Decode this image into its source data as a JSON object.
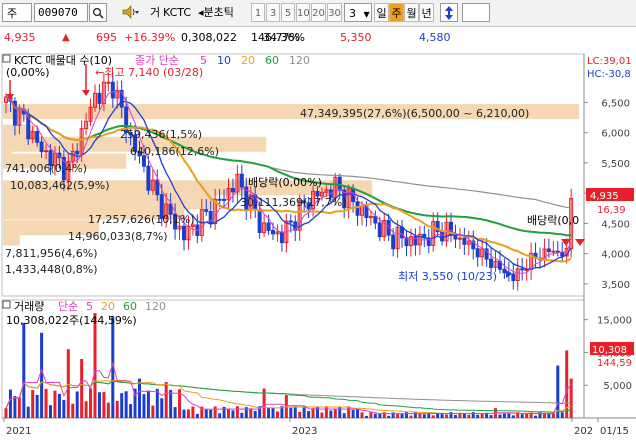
{
  "toolbar": {
    "market_btn": "주",
    "code_value": "009070",
    "search_icon": "search-icon",
    "speaker_icon": "speaker-icon",
    "name_prefix": "거",
    "stock_name": "KCTC",
    "tick_label": "◂분초틱",
    "intervals": [
      "1",
      "3",
      "5",
      "10",
      "20",
      "30"
    ],
    "count_value": "3",
    "periods": [
      "일",
      "주",
      "월",
      "년"
    ],
    "active_period": "주"
  },
  "quote": {
    "price": "4,935",
    "change": "695",
    "change_rate": "+16.39%",
    "volume": "0,308,022",
    "vol_ratio": "146.77%",
    "turnover": "34.36%",
    "high": "5,350",
    "low": "4,580"
  },
  "price_panel": {
    "legend_name": "KCTC 매물대 수(10)",
    "legend_ma_label": "종가 단순",
    "legend_ma_periods": [
      "5",
      "10",
      "20",
      "60",
      "120"
    ],
    "legend_change": "(0,00%)",
    "lc_label": "LC:39,01",
    "hc_label": "HC:-30,8",
    "high_label": "최고 7,140 (03/28)",
    "low_label": "최저 3,550 (10/23)",
    "dividend_labels": [
      "배당락(0,00%)",
      "배당락(0,0"
    ],
    "price_tag": "4,935",
    "change_tag": "16,39",
    "y_ticks": [
      "6,500",
      "6,000",
      "5,500",
      "5,000",
      "4,500",
      "4,000",
      "3,500"
    ],
    "profile_labels": [
      "47,349,395(27,6%)(6,500,00 ~ 6,210,00)",
      "259,436(1,5%)",
      "640,186(12,6%)",
      "741,006(0,4%)",
      "10,083,462(5,9%)",
      "30,111,369(17,7%)",
      "17,257,626(10,1%)",
      "14,960,033(8,7%)",
      "7,811,956(4,6%)",
      "1,433,448(0,8%)"
    ],
    "profile_fractions": [
      1.0,
      0.055,
      0.457,
      0.015,
      0.214,
      0.641,
      0.366,
      0.315,
      0.167,
      0.029
    ]
  },
  "volume_panel": {
    "legend_name": "거래량",
    "legend_ma_label": "단순",
    "legend_ma_periods": [
      "5",
      "20",
      "60",
      "120"
    ],
    "current_label": "10,308,022주(144,59%)",
    "y_ticks": [
      "15,000",
      "10,000",
      "5,000"
    ],
    "tag_value": "10,308",
    "tag_ratio": "144,59"
  },
  "x_axis": {
    "ticks": [
      "2021",
      "2023",
      "202",
      "01/15"
    ]
  },
  "colors": {
    "up": "#e8202a",
    "down": "#1c3ed0",
    "ma5": "#e040c0",
    "ma10": "#2040d0",
    "ma20": "#e8a020",
    "ma60": "#20a040",
    "ma120": "#909090",
    "profile": "#f5d7b4"
  }
}
